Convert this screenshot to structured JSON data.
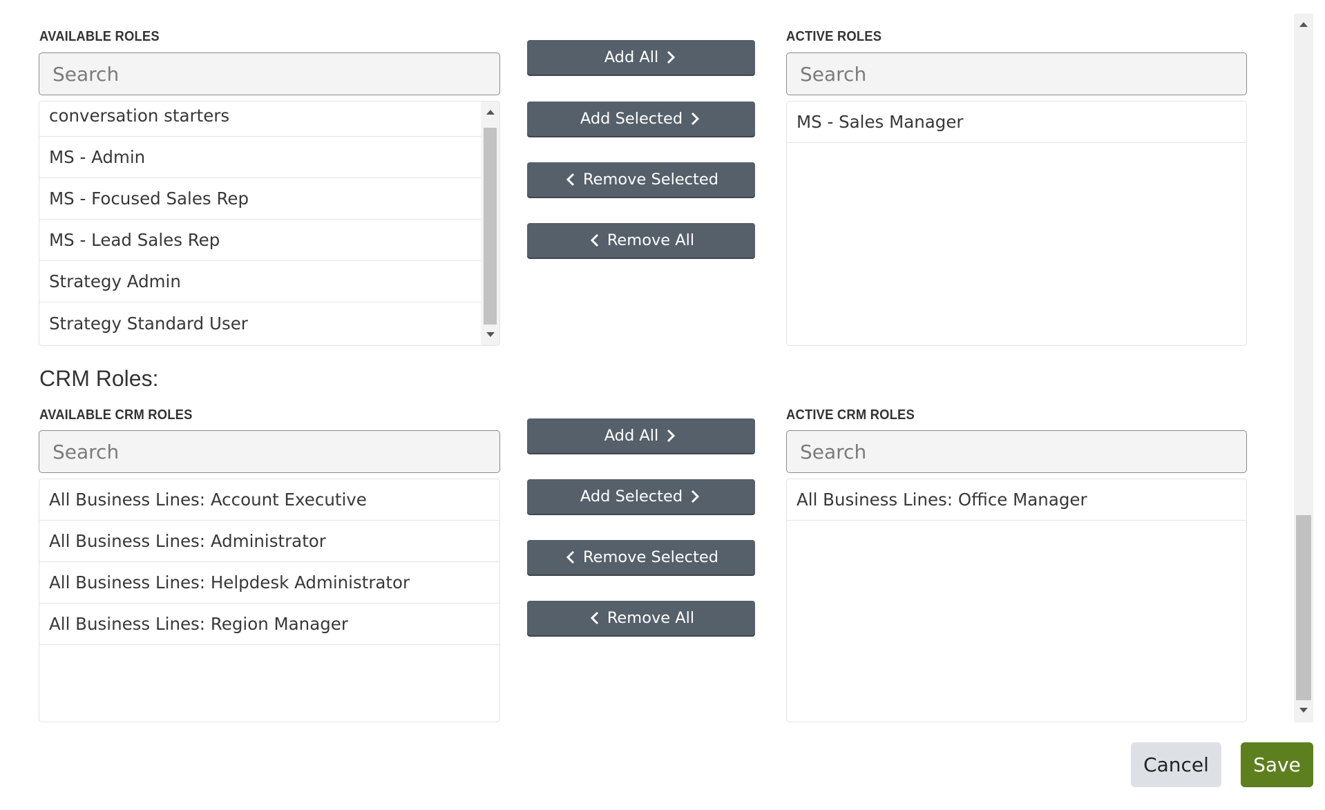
{
  "roles": {
    "available_label": "AVAILABLE ROLES",
    "active_label": "ACTIVE ROLES",
    "available_search_placeholder": "Search",
    "active_search_placeholder": "Search",
    "available_items": [
      "conversation starters",
      "MS - Admin",
      "MS - Focused Sales Rep",
      "MS - Lead Sales Rep",
      "Strategy Admin",
      "Strategy Standard User"
    ],
    "active_items": [
      "MS - Sales Manager"
    ],
    "buttons": {
      "add_all": "Add All",
      "add_selected": "Add Selected",
      "remove_selected": "Remove Selected",
      "remove_all": "Remove All"
    }
  },
  "crm": {
    "heading": "CRM Roles:",
    "available_label": "AVAILABLE CRM ROLES",
    "active_label": "ACTIVE CRM ROLES",
    "available_search_placeholder": "Search",
    "active_search_placeholder": "Search",
    "available_items": [
      "All Business Lines: Account Executive",
      "All Business Lines: Administrator",
      "All Business Lines: Helpdesk Administrator",
      "All Business Lines: Region Manager"
    ],
    "active_items": [
      "All Business Lines: Office Manager"
    ],
    "buttons": {
      "add_all": "Add All",
      "add_selected": "Add Selected",
      "remove_selected": "Remove Selected",
      "remove_all": "Remove All"
    }
  },
  "footer": {
    "cancel_label": "Cancel",
    "save_label": "Save"
  },
  "colors": {
    "button_bg": "#56606a",
    "save_bg": "#5e7f1e",
    "cancel_bg": "#dde1e6"
  }
}
